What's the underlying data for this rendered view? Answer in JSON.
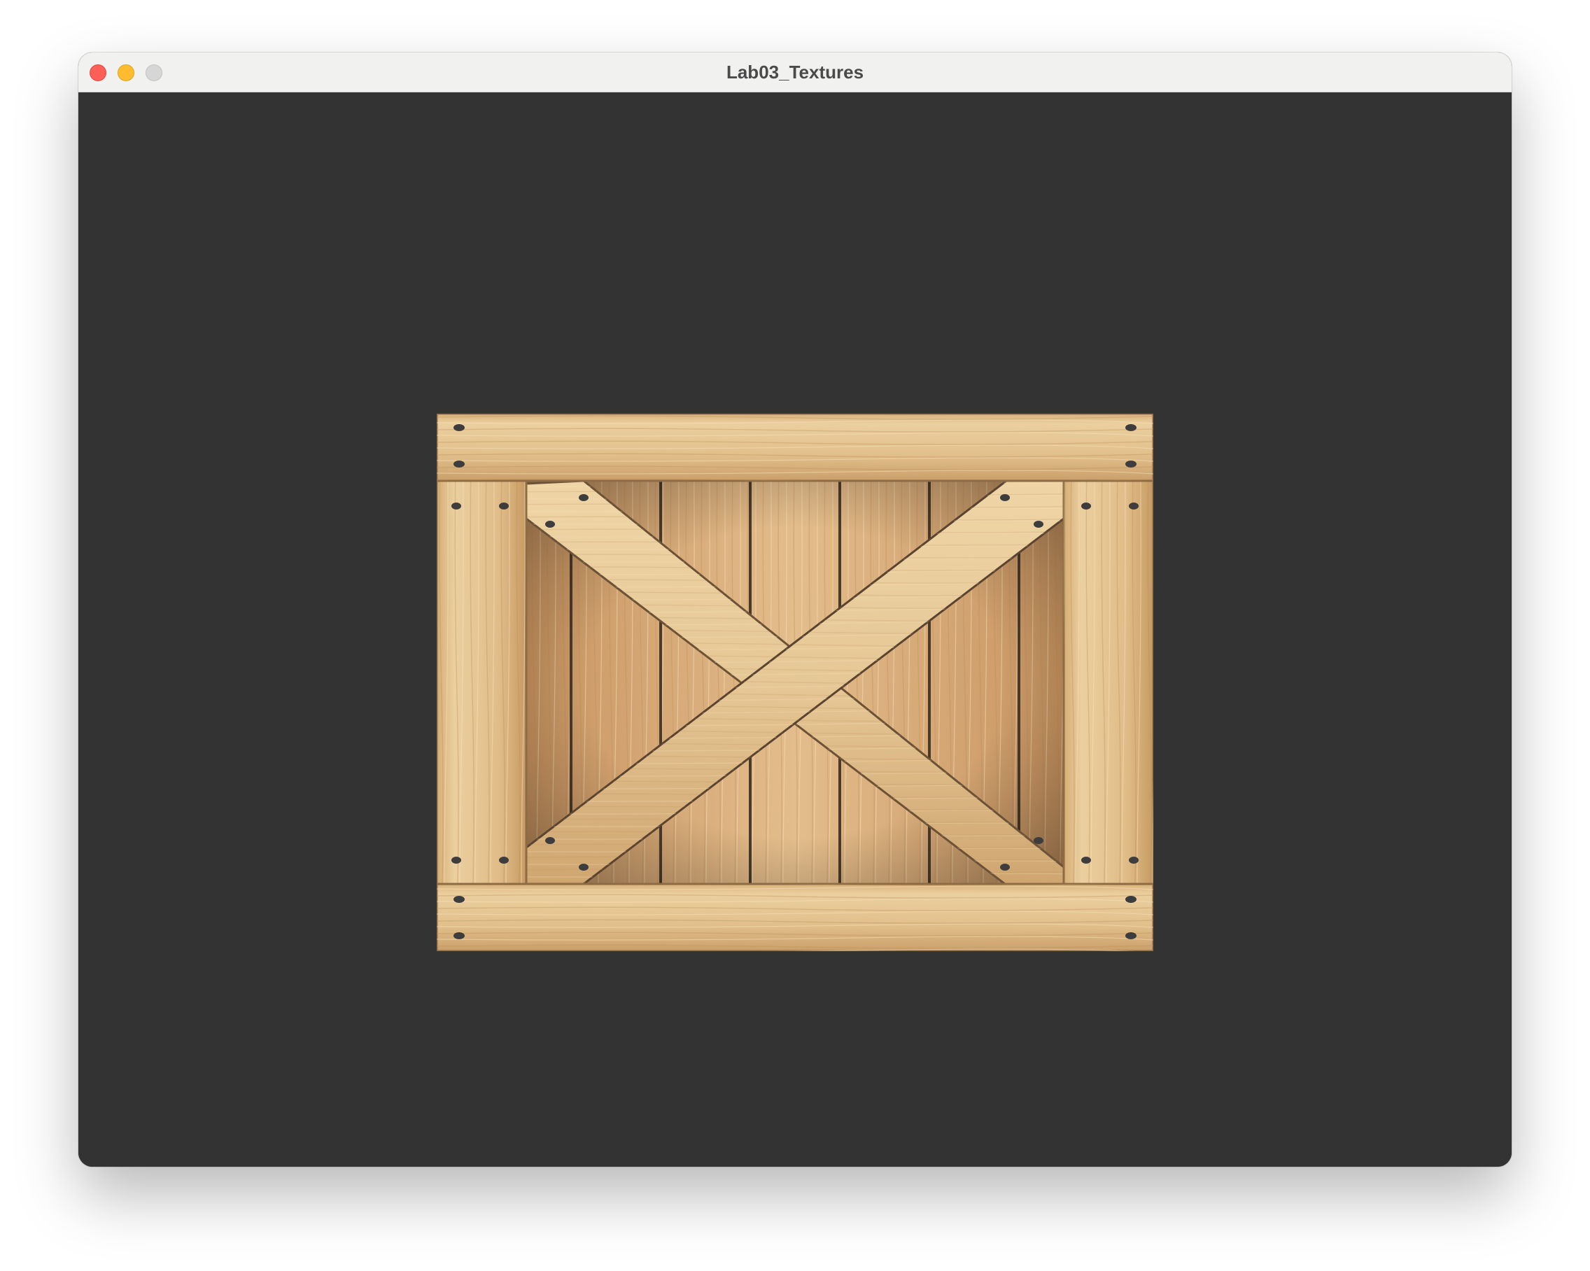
{
  "window": {
    "title": "Lab03_Textures"
  },
  "viewport": {
    "background_color": "#333333",
    "texture": "wooden-crate"
  },
  "colors": {
    "close": "#fe5f57",
    "minimize": "#febc2e",
    "zoom": "#d6d6d6",
    "wood_light": "#e6c796",
    "wood_dark": "#c9965f",
    "nail": "#3d3d3d"
  }
}
